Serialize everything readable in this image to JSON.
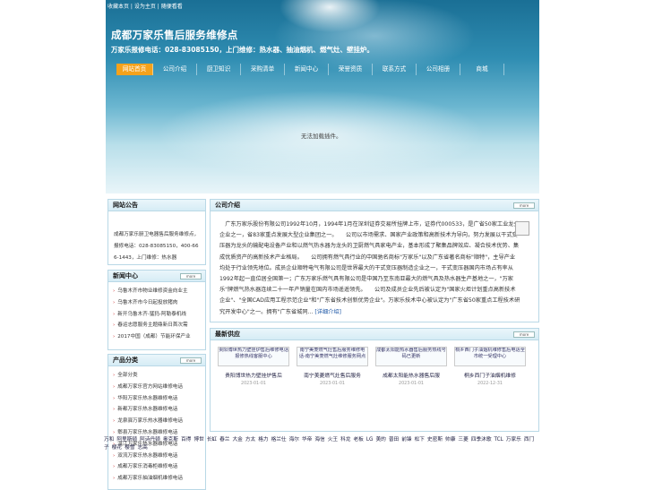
{
  "top_links": [
    "收藏本页",
    "设为主页",
    "随便看看"
  ],
  "site": {
    "title": "成都万家乐售后服务维修点",
    "subtitle": "万家乐报修电话：028-83085150，上门维修：热水器、抽油烟机、燃气灶、壁挂炉。"
  },
  "nav": [
    {
      "label": "网站首页",
      "active": true
    },
    {
      "label": "公司介绍",
      "active": false
    },
    {
      "label": "厨卫知识",
      "active": false
    },
    {
      "label": "采购清单",
      "active": false
    },
    {
      "label": "新闻中心",
      "active": false
    },
    {
      "label": "荣誉资质",
      "active": false
    },
    {
      "label": "联系方式",
      "active": false
    },
    {
      "label": "公司相册",
      "active": false
    },
    {
      "label": "商城",
      "active": false
    }
  ],
  "flash_message": "无法加载插件。",
  "notice": {
    "title": "网站公告",
    "text": "成都万家乐厨卫电器售后服务维修点，报修电话：028-83085150，400-666-1443，上门维修：热水器"
  },
  "about": {
    "title": "公司介绍",
    "text": "广东万家乐股份有限公司1992年10月，1994年1月在深圳证券交易所挂牌上市，证券代000533，是广省50家工业龙头企业之一，省83家重点发展大型企业集团之一。　　公司以市场需求、国家产业政策和高新技术为导向，努力发展以干式变压器为龙头的输配电设备产业和以燃气热水器为龙头的卫厨燃气具家电产业，基本形成了聚集品牌效应、凝合技术优势、集成优质资产的高新技术产业格局。　　公司拥有燃气具行业的中国驰名商标\"万家乐\"以及广东省著名商标\"顺特\"，主导产业均处于行业领先地位。成员企业顺特电气有限公司是世界最大的干式变压器制造企业之一，干式变压器国内市场占有率从1992年起一直位居全国第一；广东万家乐燃气具有限公司是中国乃至东南亚最大的燃气具及热水器生产基地之一，\"万家乐\"牌燃气热水器连续二十一年产销量在国内市场遥遥领先。　　公司及成员企业先后被认定为\"国家火炬计划重点高新技术企业\"、\"全国CAD应用工程示范企业\"和\"广东省技术创新优势企业\"。万家乐技术中心被认定为\"广东省50家重点工程技术研究开发中心\"之一。拥有\"广东省城同...",
    "more_link": "[详细介绍]",
    "more_label": "more"
  },
  "news": {
    "title": "新闻中心",
    "more_label": "more",
    "items": [
      "乌鲁木齐市物业维修资金向业主",
      "乌鲁木齐市今日起投放猪肉",
      "新开乌鲁木齐-猛犸-阿勒泰机线",
      "春运志愿服务主题鼎新日首次需",
      "2017中国（成都）节能环保产业"
    ]
  },
  "products": {
    "title": "产品分类",
    "more_label": "more",
    "items": [
      "全部分类",
      "成都万家乐官方网站维修电话",
      "华阳万家乐热水器维修电话",
      "新都万家乐热水器维修电话",
      "龙泉驿万家乐热水器维修电话",
      "郫县万家乐热水器维修电话",
      "温江万家乐热水器维修电话",
      "双流万家乐热水器维修电话",
      "成都万家乐消毒柜维修电话",
      "成都万家乐抽油烟机维修电话"
    ]
  },
  "supply": {
    "title": "最新供应",
    "more_label": "more",
    "items": [
      {
        "thumb": "贵阳博世热力壁挂炉售后维修电话报修热线客服中心",
        "name": "贵阳博世热力壁挂炉售后",
        "date": "2023-01-01"
      },
      {
        "thumb": "南宁美菱燃气灶售后服务维修电话-南宁美菱燃气灶维修服务网点",
        "name": "南宁美菱燃气灶售后服务",
        "date": "2023-01-01"
      },
      {
        "thumb": "成都太阳能热水器售后服务热线号码已更新",
        "name": "成都太阳能热水器售后服",
        "date": "2023-01-01"
      },
      {
        "thumb": "桐乡西门子油烟机维修售后电话全市统一受理中心",
        "name": "桐乡西门子油烟机维修",
        "date": "2022-12-31"
      }
    ]
  },
  "friend_links": [
    "万和",
    "阿里斯顿",
    "阿诗丹顿",
    "奥克斯",
    "百得",
    "博世",
    "长虹",
    "春兰",
    "大金",
    "方太",
    "格力",
    "格兰仕",
    "海尔",
    "华帝",
    "海信",
    "火王",
    "科龙",
    "老板",
    "LG",
    "美的",
    "普田",
    "前锋",
    "松下",
    "史密斯",
    "帅康",
    "三菱",
    "四季沐歌",
    "TCL",
    "万家乐",
    "西门子",
    "樱花",
    "樱雪",
    "志高"
  ],
  "colors": {
    "nav_active": "#f5a21b",
    "border": "#b9d8e6"
  }
}
